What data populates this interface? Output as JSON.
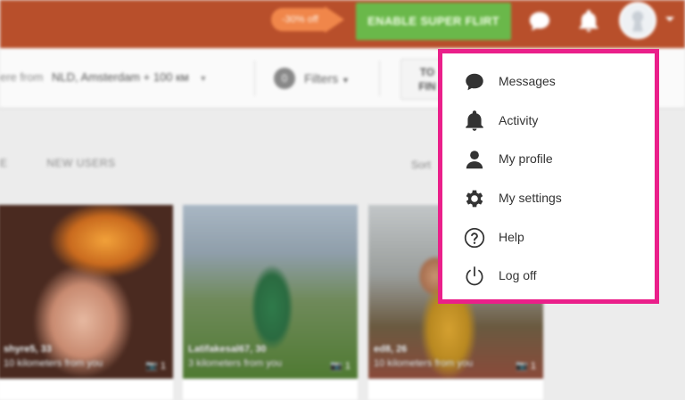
{
  "header": {
    "promo_badge": "-30% off",
    "super_flirt_button": "ENABLE SUPER FLIRT",
    "icons": [
      "chat-bubble-icon",
      "bell-icon",
      "avatar"
    ],
    "colors": {
      "topbar": "#b84f2b",
      "promo": "#f0864a",
      "cta": "#6ab84a"
    }
  },
  "filters": {
    "location_prefix": "ere from",
    "location_value": "NLD, Amsterdam + 100 км",
    "filters_count": "0",
    "filters_label": "Filters",
    "top_finder_line1": "TO",
    "top_finder_line2": "FIN"
  },
  "tabs": {
    "partial_tab": "E",
    "new_users": "NEW USERS",
    "sort_label": "Sort"
  },
  "cards": [
    {
      "name": "shyre5, 33",
      "distance": "10 kilometers from you",
      "photos": "1"
    },
    {
      "name": "Latifakesal67, 30",
      "distance": "3 kilometers from you",
      "photos": "1"
    },
    {
      "name": "ed8, 26",
      "distance": "10 kilometers from you",
      "photos": "1"
    }
  ],
  "menu": {
    "highlight_color": "#ea1f8a",
    "items": [
      {
        "label": "Messages",
        "icon": "chat-bubble-icon"
      },
      {
        "label": "Activity",
        "icon": "bell-icon"
      },
      {
        "label": "My profile",
        "icon": "person-icon"
      },
      {
        "label": "My settings",
        "icon": "gear-icon"
      },
      {
        "label": "Help",
        "icon": "question-circle-icon"
      },
      {
        "label": "Log off",
        "icon": "power-icon"
      }
    ]
  }
}
